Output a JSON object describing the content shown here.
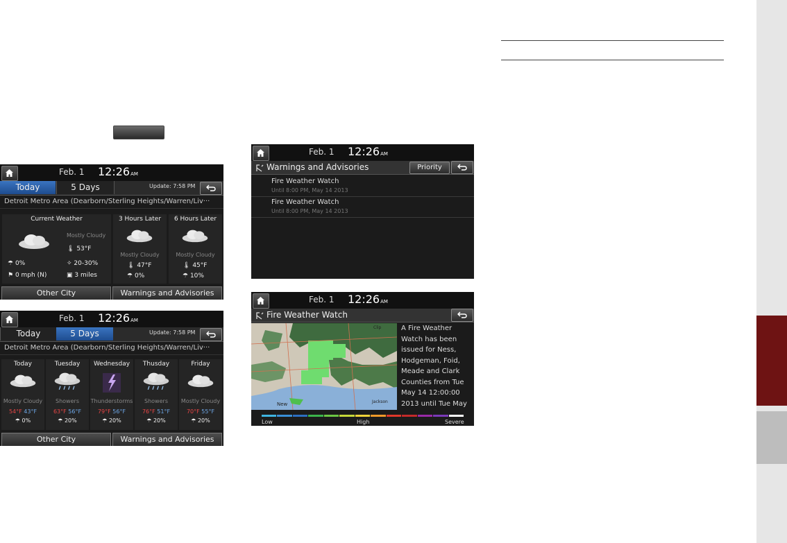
{
  "status_bar": {
    "date": "Feb.  1",
    "time": "12:26",
    "ampm": "AM"
  },
  "current_screen": {
    "tabs": [
      "Today",
      "5 Days"
    ],
    "update": "Update: 7:58 PM",
    "location": "Detroit Metro Area (Dearborn/Sterling Heights/Warren/Liv···",
    "current": {
      "header": "Current Weather",
      "condition": "Mostly Cloudy",
      "temp": "53°F",
      "precip": "0%",
      "precip_range": "20-30%",
      "wind": "0 mph (N)",
      "visibility": "3 miles"
    },
    "later": [
      {
        "header": "3 Hours Later",
        "condition": "Mostly Cloudy",
        "temp": "47°F",
        "precip": "0%"
      },
      {
        "header": "6 Hours Later",
        "condition": "Mostly Cloudy",
        "temp": "45°F",
        "precip": "10%"
      }
    ],
    "buttons": [
      "Other City",
      "Warnings and Advisories"
    ]
  },
  "five_day_screen": {
    "tabs": [
      "Today",
      "5 Days"
    ],
    "update": "Update: 7:58 PM",
    "location": "Detroit Metro Area (Dearborn/Sterling Heights/Warren/Liv···",
    "days": [
      {
        "name": "Today",
        "condition": "Mostly Cloudy",
        "high": "54°F",
        "low": "43°F",
        "precip": "0%"
      },
      {
        "name": "Tuesday",
        "condition": "Showers",
        "high": "63°F",
        "low": "56°F",
        "precip": "20%"
      },
      {
        "name": "Wednesday",
        "condition": "Thunderstorms",
        "high": "79°F",
        "low": "56°F",
        "precip": "20%"
      },
      {
        "name": "Thusday",
        "condition": "Showers",
        "high": "76°F",
        "low": "51°F",
        "precip": "20%"
      },
      {
        "name": "Friday",
        "condition": "Mostly Cloudy",
        "high": "70°F",
        "low": "55°F",
        "precip": "20%"
      }
    ],
    "buttons": [
      "Other City",
      "Warnings and Advisories"
    ]
  },
  "warnings_screen": {
    "title": "Warnings and Advisories",
    "priority_label": "Priority",
    "items": [
      {
        "title": "Fire Weather Watch",
        "until": "Until 8:00 PM, May 14 2013"
      },
      {
        "title": "Fire Weather Watch",
        "until": "Until 8:00 PM, May 14 2013"
      }
    ]
  },
  "fire_screen": {
    "title": "Fire Weather Watch",
    "advisory_lines": [
      "A Fire Weather",
      "Watch has been",
      "issued for Ness,",
      "Hodgeman, Foid,",
      "Meade and Clark",
      "Counties from Tue",
      "May 14 12:00:00",
      "2013 until Tue May"
    ],
    "map_labels": {
      "new": "New",
      "jackson": "Jackson",
      "clip": "Clip"
    },
    "legend": {
      "low": "Low",
      "high": "High",
      "severe": "Severe",
      "colors": [
        "#3fb4e0",
        "#3a8fd8",
        "#2d6fc2",
        "#3cb44b",
        "#6cc644",
        "#c6d83a",
        "#f0d23a",
        "#f09a2a",
        "#e0382a",
        "#c42a2a",
        "#9a2aa8",
        "#7a3ab8",
        "#ffffff"
      ]
    }
  },
  "colors": {
    "accent_tab": "#2f67b3",
    "side_red": "#6e1313",
    "side_gray": "#bdbdbd",
    "side_bg": "#e6e6e6"
  }
}
